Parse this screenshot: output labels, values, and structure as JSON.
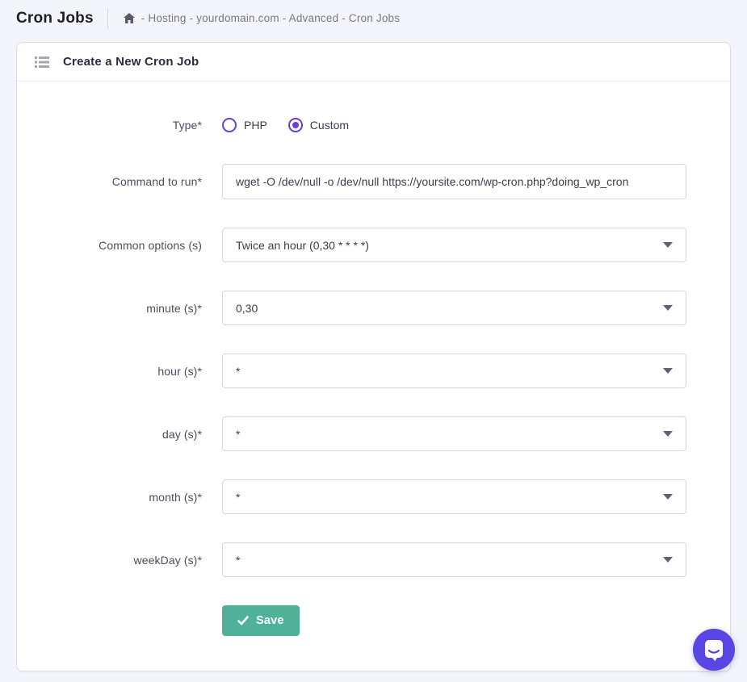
{
  "page": {
    "title": "Cron Jobs",
    "breadcrumb": "- Hosting - yourdomain.com - Advanced - Cron Jobs"
  },
  "card": {
    "title": "Create a New Cron Job"
  },
  "form": {
    "type": {
      "label": "Type*",
      "options": [
        {
          "label": "PHP",
          "selected": false
        },
        {
          "label": "Custom",
          "selected": true
        }
      ]
    },
    "command": {
      "label": "Command to run*",
      "value": "wget -O /dev/null -o /dev/null https://yoursite.com/wp-cron.php?doing_wp_cron"
    },
    "common_options": {
      "label": "Common options (s)",
      "value": "Twice an hour (0,30 * * * *)"
    },
    "minute": {
      "label": "minute (s)*",
      "value": "0,30"
    },
    "hour": {
      "label": "hour (s)*",
      "value": "*"
    },
    "day": {
      "label": "day (s)*",
      "value": "*"
    },
    "month": {
      "label": "month (s)*",
      "value": "*"
    },
    "weekday": {
      "label": "weekDay (s)*",
      "value": "*"
    },
    "save_label": "Save"
  },
  "colors": {
    "accent_purple": "#673de6",
    "save_green": "#4fb298",
    "chat_purple": "#5847e5",
    "page_background": "#f4f4fb"
  }
}
